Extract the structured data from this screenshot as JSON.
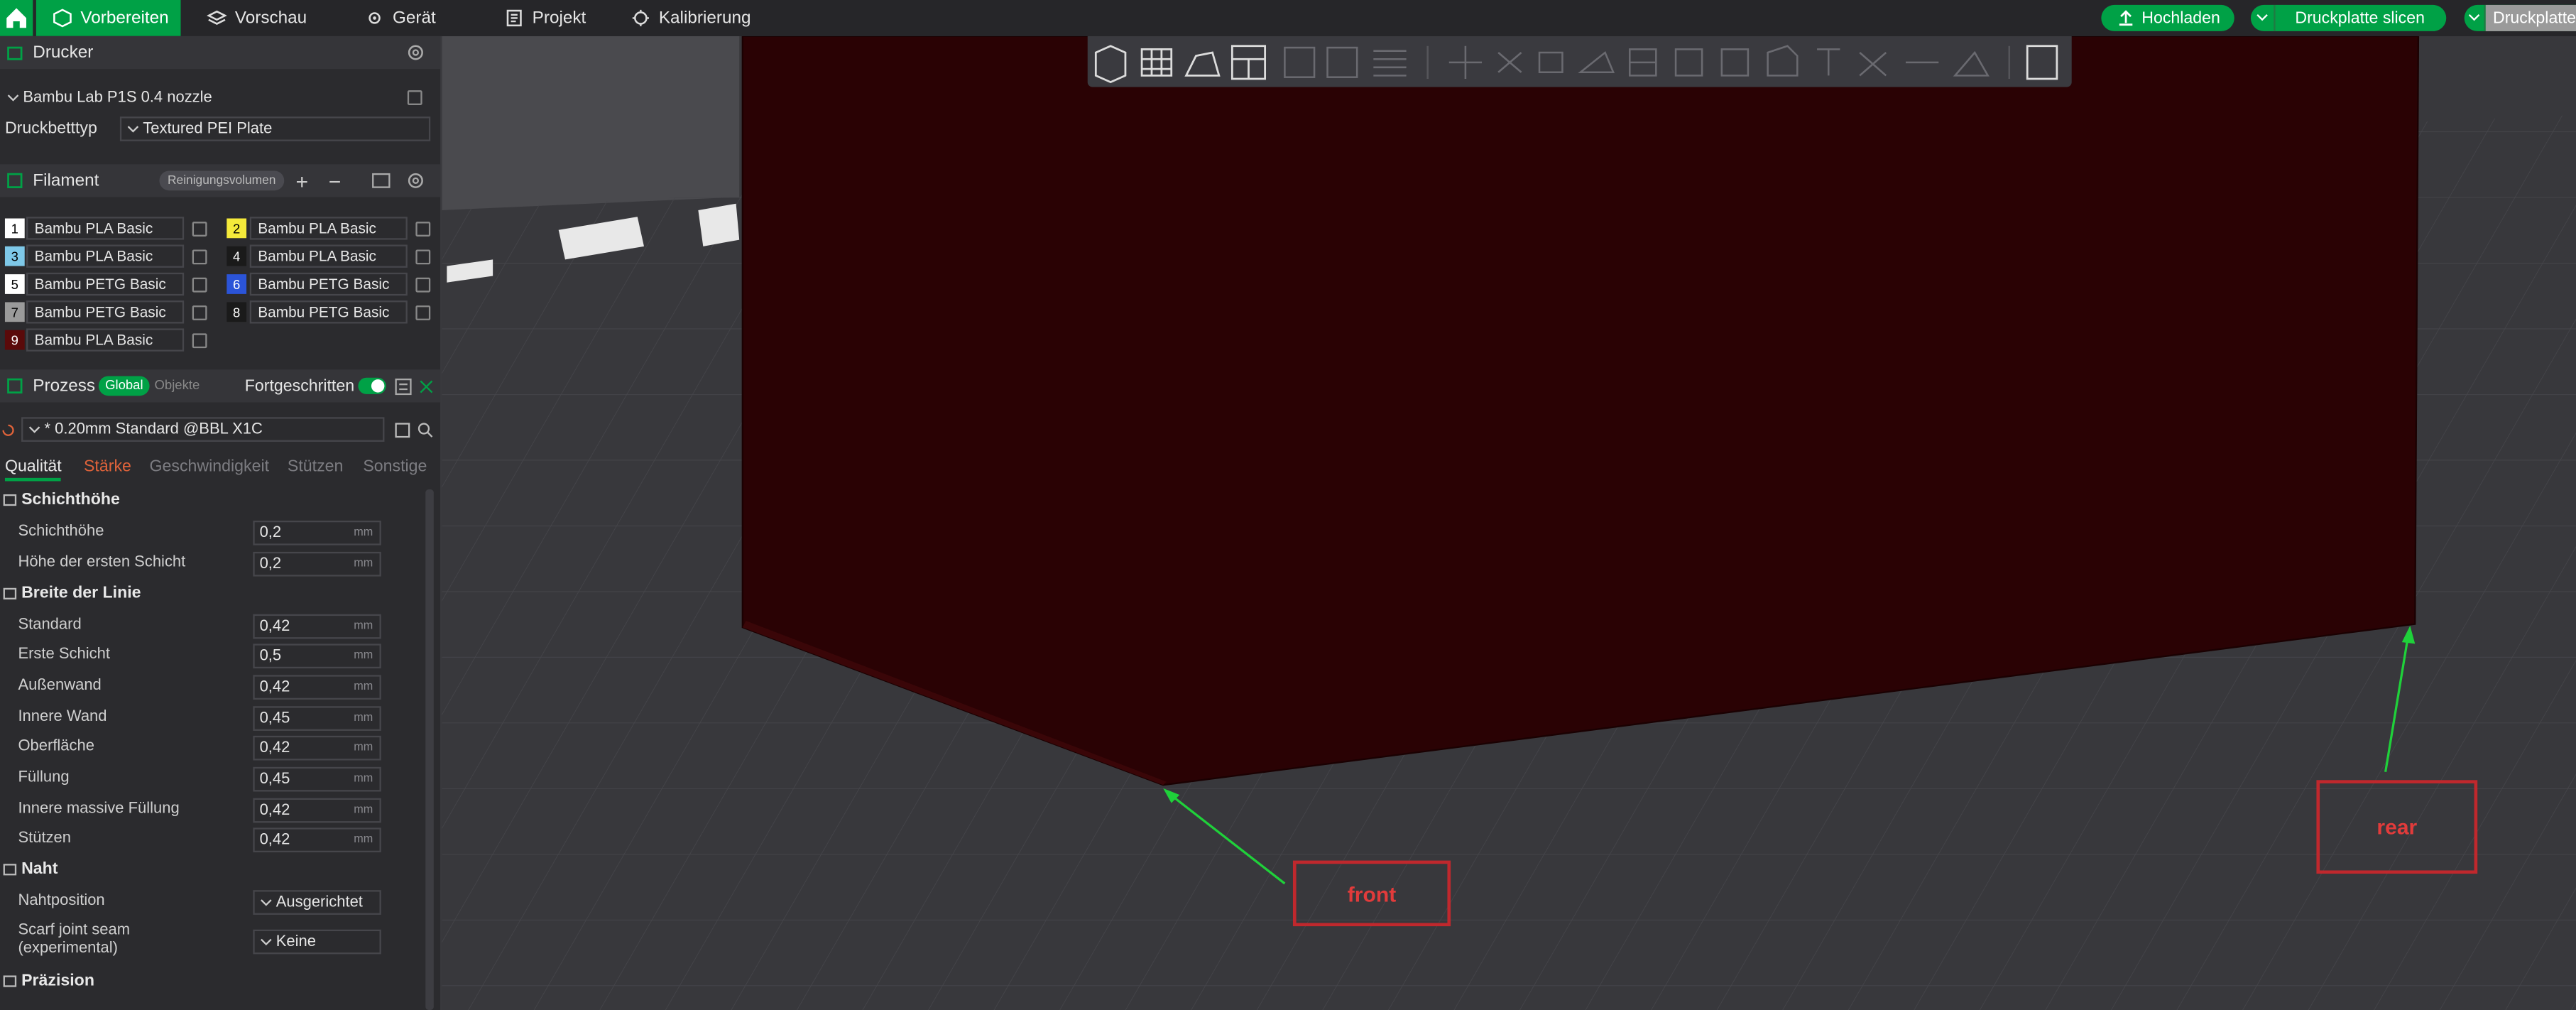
{
  "topbar": {
    "tabs": [
      {
        "label": "Vorbereiten",
        "icon": "cube-icon"
      },
      {
        "label": "Vorschau",
        "icon": "layers-icon"
      },
      {
        "label": "Gerät",
        "icon": "gear-icon"
      },
      {
        "label": "Projekt",
        "icon": "document-icon"
      },
      {
        "label": "Kalibrierung",
        "icon": "calibration-icon"
      }
    ],
    "upload_label": "Hochladen",
    "slice_label": "Druckplatte slicen",
    "print_label": "Druckplatte"
  },
  "printer": {
    "section_title": "Drucker",
    "printer_name": "Bambu Lab P1S 0.4 nozzle",
    "bed_label": "Druckbetttyp",
    "bed_value": "Textured PEI Plate"
  },
  "filament": {
    "section_title": "Filament",
    "purge_label": "Reinigungsvolumen",
    "slots": [
      {
        "num": "1",
        "name": "Bambu PLA Basic",
        "color": "#ffffff",
        "text": "#000000"
      },
      {
        "num": "2",
        "name": "Bambu PLA Basic",
        "color": "#f5ea3a",
        "text": "#000000"
      },
      {
        "num": "3",
        "name": "Bambu PLA Basic",
        "color": "#7ec8e8",
        "text": "#000000"
      },
      {
        "num": "4",
        "name": "Bambu PLA Basic",
        "color": "#1a1a1a",
        "text": "#ffffff"
      },
      {
        "num": "5",
        "name": "Bambu PETG Basic",
        "color": "#ffffff",
        "text": "#000000"
      },
      {
        "num": "6",
        "name": "Bambu PETG Basic",
        "color": "#2b54d8",
        "text": "#ffffff"
      },
      {
        "num": "7",
        "name": "Bambu PETG Basic",
        "color": "#9a9a9a",
        "text": "#000000"
      },
      {
        "num": "8",
        "name": "Bambu PETG Basic",
        "color": "#1a1a1a",
        "text": "#ffffff"
      },
      {
        "num": "9",
        "name": "Bambu PLA Basic",
        "color": "#5a0a0a",
        "text": "#ffffff"
      }
    ]
  },
  "process": {
    "section_title": "Prozess",
    "toggle_global": "Global",
    "toggle_objects": "Objekte",
    "advanced_label": "Fortgeschritten",
    "preset": "* 0.20mm Standard @BBL X1C",
    "tabs": [
      "Qualität",
      "Stärke",
      "Geschwindigkeit",
      "Stützen",
      "Sonstige"
    ],
    "groups": {
      "layer_height": "Schichthöhe",
      "line_width": "Breite der Linie",
      "seam": "Naht",
      "precision": "Präzision"
    },
    "params": [
      {
        "label": "Schichthöhe",
        "value": "0,2",
        "unit": "mm"
      },
      {
        "label": "Höhe der ersten Schicht",
        "value": "0,2",
        "unit": "mm"
      },
      {
        "label": "Standard",
        "value": "0,42",
        "unit": "mm"
      },
      {
        "label": "Erste Schicht",
        "value": "0,5",
        "unit": "mm"
      },
      {
        "label": "Außenwand",
        "value": "0,42",
        "unit": "mm"
      },
      {
        "label": "Innere Wand",
        "value": "0,45",
        "unit": "mm"
      },
      {
        "label": "Oberfläche",
        "value": "0,42",
        "unit": "mm"
      },
      {
        "label": "Füllung",
        "value": "0,45",
        "unit": "mm"
      },
      {
        "label": "Innere massive Füllung",
        "value": "0,42",
        "unit": "mm"
      },
      {
        "label": "Stützen",
        "value": "0,42",
        "unit": "mm"
      }
    ],
    "seam_position_label": "Nahtposition",
    "seam_position_value": "Ausgerichtet",
    "scarf_label": "Scarf joint seam (experimental)",
    "scarf_value": "Keine"
  },
  "viewport": {
    "annotation_front": "front",
    "annotation_rear": "rear",
    "colors": {
      "object": "#2a0204",
      "plate": "#36363a",
      "annotation": "#c0282d",
      "arrow": "#1fd13a"
    }
  }
}
